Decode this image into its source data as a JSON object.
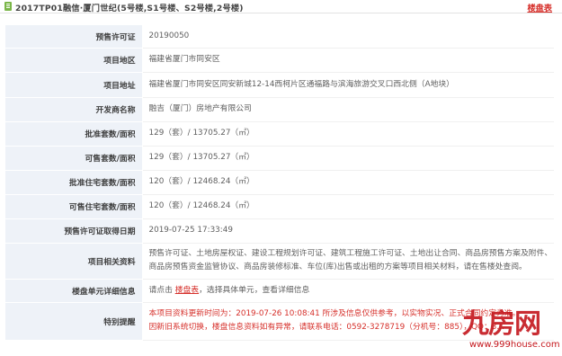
{
  "header": {
    "title": "2017TP01融信·厦门世纪(5号楼,S1号楼、S2号楼,2号楼)",
    "link_label": "楼盘表"
  },
  "rows": [
    {
      "label": "预售许可证",
      "value": "20190050"
    },
    {
      "label": "项目地区",
      "value": "福建省厦门市同安区"
    },
    {
      "label": "项目地址",
      "value": "福建省厦门市同安区同安新城12-14西柯片区通福路与滨海旅游交叉口西北侧（A地块）"
    },
    {
      "label": "开发商名称",
      "value": "融吉（厦门）房地产有限公司"
    },
    {
      "label": "批准套数/面积",
      "value": "129（套）/ 13705.27（㎡）"
    },
    {
      "label": "可售套数/面积",
      "value": "129（套）/ 13705.27（㎡）"
    },
    {
      "label": "批准住宅套数/面积",
      "value": "120（套）/ 12468.24（㎡）"
    },
    {
      "label": "可售住宅套数/面积",
      "value": "120（套）/ 12468.24（㎡）"
    },
    {
      "label": "预售许可证取得日期",
      "value": "2019-07-25 17:33:49"
    },
    {
      "label": "项目相关资料",
      "value": "预售许可证、土地房屋权证、建设工程规划许可证、建筑工程施工许可证、土地出让合同、商品房预售方案及附件、商品房预售资金监管协议、商品房装修标准、车位(库)出售或出租的方案等项目相关材料，请在售楼处查阅。"
    },
    {
      "label": "楼盘单元详细信息",
      "value_prefix": "请点击",
      "value_link": "楼盘表",
      "value_suffix": "，选择具体单元，查看详细信息"
    },
    {
      "label": "特别提醒",
      "value_line1": "本项目资料更新时间为：2019-07-26 10:08:41 所涉及信息仅供参考，以实物实况、正式合同约定为准。",
      "value_line2": "因新旧系统切换，楼盘信息资料如有异常，请联系电话：0592-3278719（分机号：885），QQ：3..."
    }
  ],
  "watermark": {
    "logo": "九房网",
    "url": "www.999house.com"
  },
  "colors": {
    "label_bg": "#eef2f8",
    "accent_red": "#d6302b",
    "icon_green": "#7ab648"
  }
}
